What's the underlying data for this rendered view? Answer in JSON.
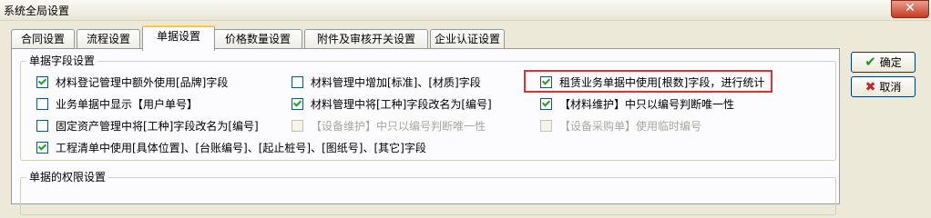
{
  "window": {
    "title": "系统全局设置",
    "close_label": "✕"
  },
  "tabs": [
    {
      "label": "合同设置",
      "active": false
    },
    {
      "label": "流程设置",
      "active": false
    },
    {
      "label": "单据设置",
      "active": true
    },
    {
      "label": "价格数量设置",
      "active": false
    },
    {
      "label": "附件及审核开关设置",
      "active": false
    },
    {
      "label": "企业认证设置",
      "active": false
    }
  ],
  "groups": {
    "fields": {
      "title": "单据字段设置"
    },
    "permissions": {
      "title": "单据的权限设置"
    }
  },
  "checkboxes": [
    {
      "label": "材料登记管理中额外使用[品牌]字段",
      "checked": true,
      "disabled": false
    },
    {
      "label": "材料管理中增加[标准]、[材质]字段",
      "checked": false,
      "disabled": false
    },
    {
      "label": "租赁业务单据中使用[根数]字段，进行统计",
      "checked": true,
      "disabled": false
    },
    {
      "label": "业务单据中显示【用户单号】",
      "checked": false,
      "disabled": false
    },
    {
      "label": "材料管理中将[工种]字段改名为[编号]",
      "checked": true,
      "disabled": false
    },
    {
      "label": "【材料维护】中只以编号判断唯一性",
      "checked": true,
      "disabled": false
    },
    {
      "label": "固定资产管理中将[工种]字段改名为[编号]",
      "checked": false,
      "disabled": false
    },
    {
      "label": "【设备维护】中只以编号判断唯一性",
      "checked": false,
      "disabled": true
    },
    {
      "label": "【设备采购单】使用临时编号",
      "checked": false,
      "disabled": true
    },
    {
      "label": "工程清单中使用[具体位置]、[台账编号]、[起止桩号]、[图纸号]、[其它]字段",
      "checked": true,
      "disabled": false
    }
  ],
  "buttons": {
    "ok_label": "确定",
    "cancel_label": "取消"
  }
}
